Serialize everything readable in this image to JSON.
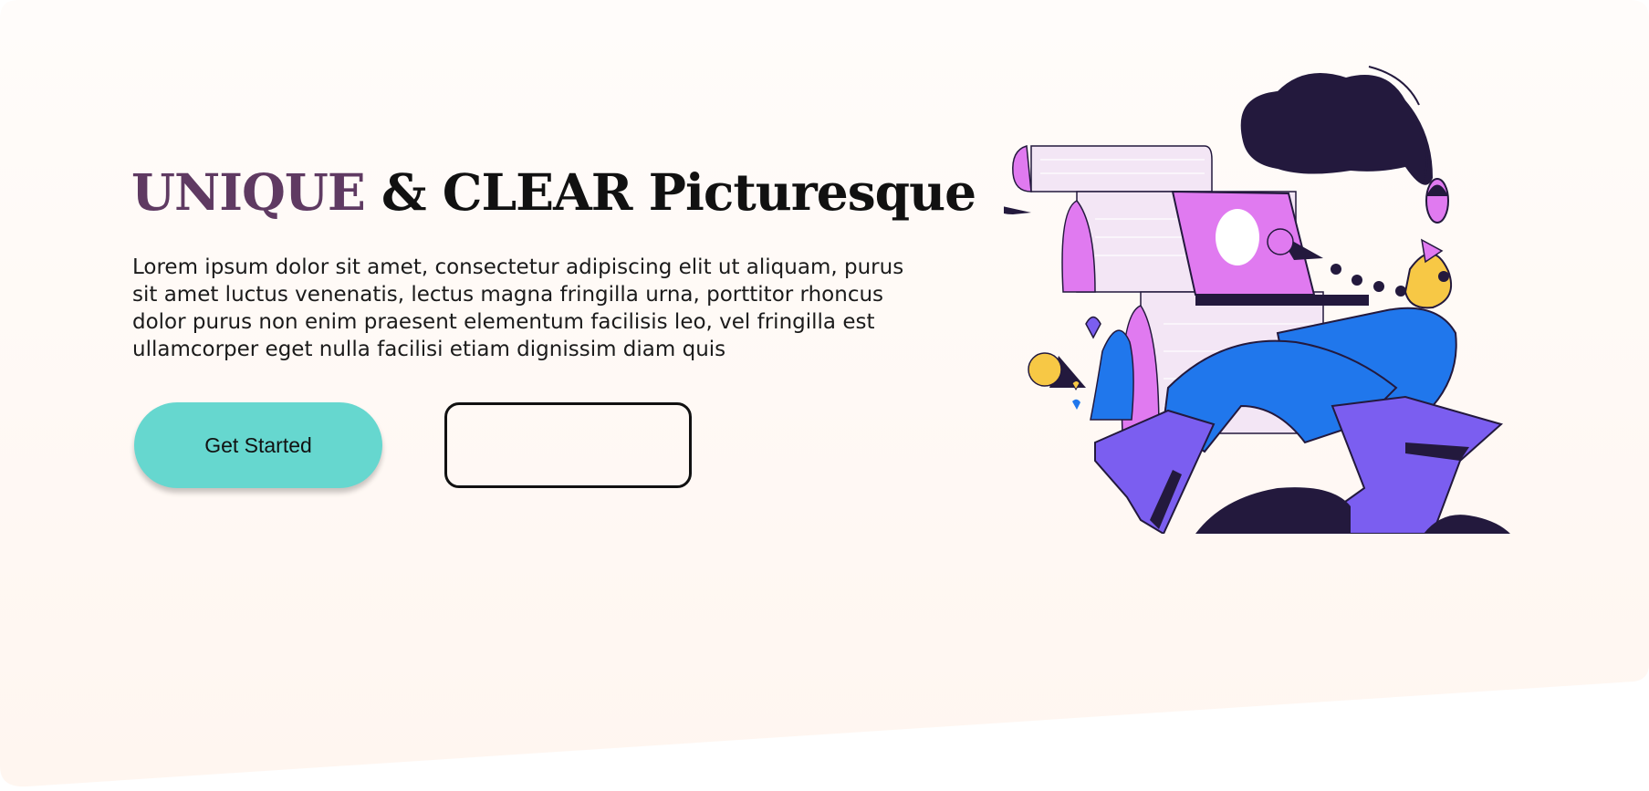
{
  "hero": {
    "title_accent": "UNIQUE",
    "title_rest": " & CLEAR Picturesque",
    "description": "Lorem ipsum dolor sit amet, consectetur adipiscing elit ut aliquam, purus sit amet luctus venenatis, lectus magna fringilla urna, porttitor rhoncus dolor purus non enim praesent elementum facilisis leo, vel fringilla est ullamcorper eget nulla facilisi etiam dignissim diam quis",
    "primary_button_label": "Get Started",
    "secondary_button_label": ""
  },
  "colors": {
    "accent_title": "#5f3a62",
    "primary_button": "#66d7cf",
    "background": "#fffaf7",
    "illustration_dark": "#23193d",
    "illustration_pink": "#e07af0",
    "illustration_blue": "#2077ec",
    "illustration_purple": "#7b5ef0",
    "illustration_yellow": "#f7c845"
  },
  "illustration": {
    "icon": "person-writing-scroll-illustration"
  }
}
